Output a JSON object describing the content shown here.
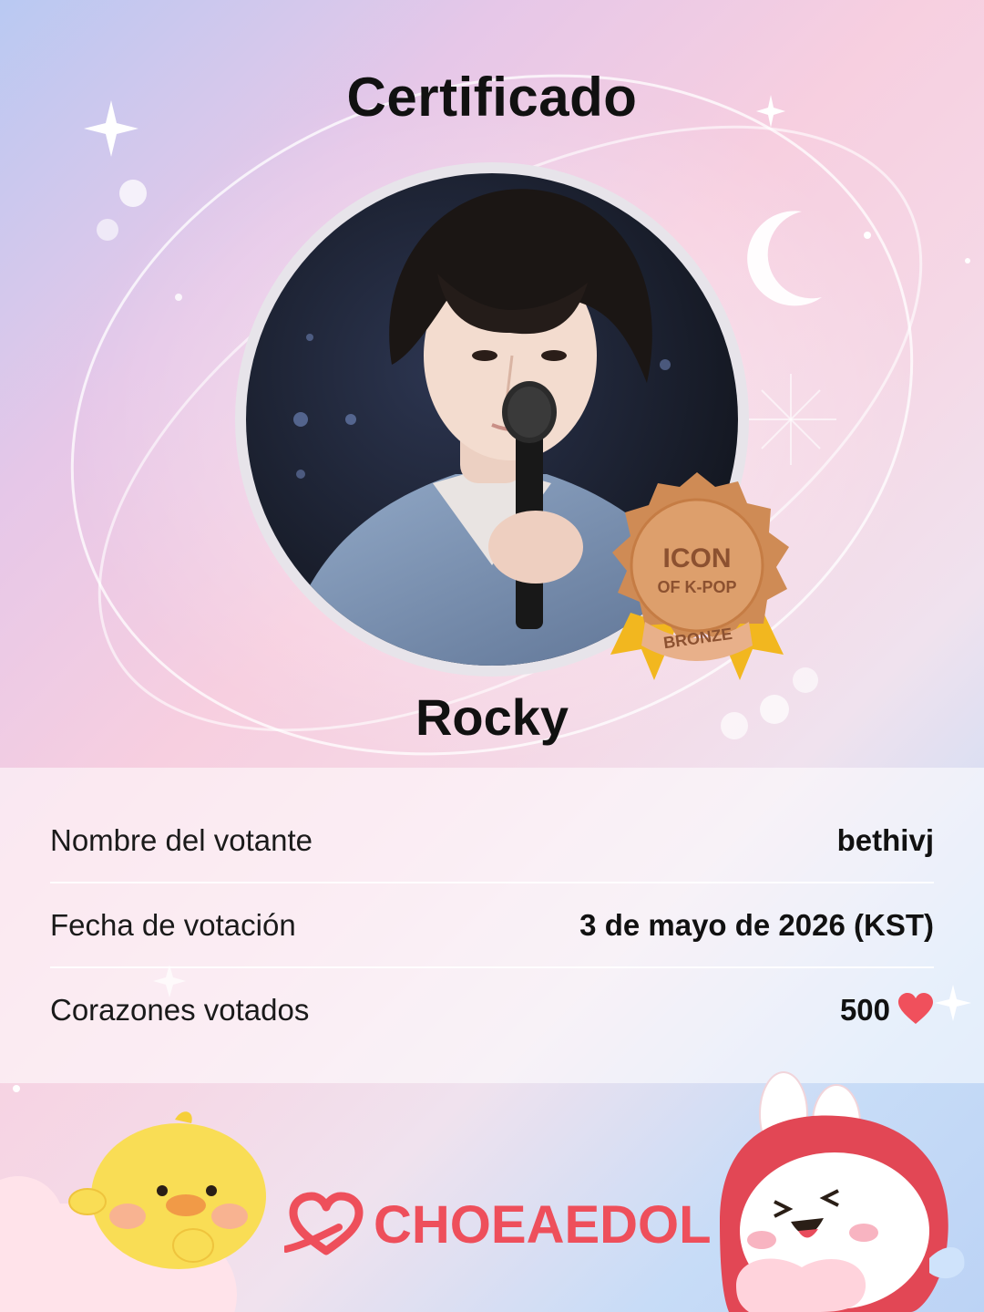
{
  "certificate": {
    "title": "Certificado",
    "idol_name": "Rocky",
    "badge": {
      "line1": "ICON",
      "line2": "OF K-POP",
      "tier": "BRONZE"
    },
    "rows": [
      {
        "label": "Nombre del votante",
        "value": "bethivj"
      },
      {
        "label": "Fecha de votación",
        "value": "3 de mayo de 2026 (KST)"
      },
      {
        "label": "Corazones votados",
        "value": "500"
      }
    ]
  },
  "brand": {
    "name": "CHOEAEDOL"
  },
  "icons": {
    "heart": "heart-icon",
    "sparkle": "sparkle-icon",
    "moon": "moon-icon",
    "chick": "chick-mascot",
    "bunny": "bunny-mascot",
    "brand_logo": "choeaedol-logo-icon",
    "photo": "idol-photo"
  },
  "colors": {
    "brand_red": "#ee4f5b",
    "heart_red": "#f0505c",
    "badge_bronze": "#cf8b55"
  }
}
